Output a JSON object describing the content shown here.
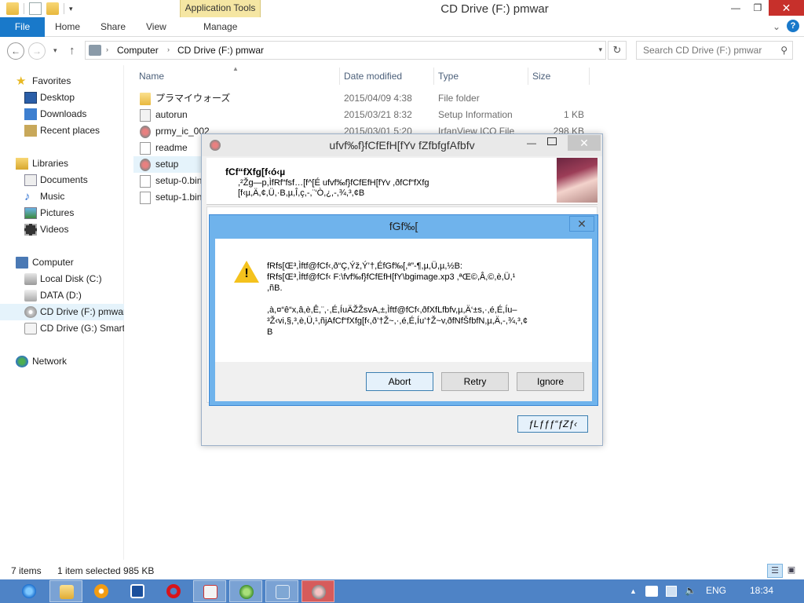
{
  "window": {
    "title": "CD Drive (F:) pmwar",
    "contextual_tab": "Application Tools",
    "minimize": "—",
    "maximize": "❐",
    "close": "✕"
  },
  "ribbon": {
    "tabs": [
      "File",
      "Home",
      "Share",
      "View",
      "Manage"
    ],
    "expand": "⌄",
    "help": "?"
  },
  "address": {
    "back": "←",
    "forward": "→",
    "up": "↑",
    "crumbs": [
      "Computer",
      "CD Drive (F:) pmwar"
    ],
    "refresh": "↻",
    "search_placeholder": "Search CD Drive (F:) pmwar"
  },
  "navpane": {
    "favorites": "Favorites",
    "fav_items": [
      "Desktop",
      "Downloads",
      "Recent places"
    ],
    "libraries": "Libraries",
    "lib_items": [
      "Documents",
      "Music",
      "Pictures",
      "Videos"
    ],
    "computer": "Computer",
    "comp_items": [
      "Local Disk (C:)",
      "DATA (D:)",
      "CD Drive (F:) pmwar",
      "CD Drive (G:) Smartf"
    ],
    "network": "Network"
  },
  "filelist": {
    "columns": [
      "Name",
      "Date modified",
      "Type",
      "Size"
    ],
    "rows": [
      {
        "name": "プラマイウォーズ",
        "date": "2015/04/09 4:38",
        "type": "File folder",
        "size": ""
      },
      {
        "name": "autorun",
        "date": "2015/03/21 8:32",
        "type": "Setup Information",
        "size": "1 KB"
      },
      {
        "name": "prmy_ic_002",
        "date": "2015/03/01 5:20",
        "type": "IrfanView ICO File",
        "size": "298 KB"
      },
      {
        "name": "readme",
        "date": "",
        "type": "",
        "size": ""
      },
      {
        "name": "setup",
        "date": "",
        "type": "",
        "size": ""
      },
      {
        "name": "setup-0.bin",
        "date": "",
        "type": "",
        "size": ""
      },
      {
        "name": "setup-1.bin",
        "date": "",
        "type": "",
        "size": ""
      }
    ]
  },
  "status": {
    "count": "7 items",
    "selected": "1 item selected  985 KB"
  },
  "installer": {
    "title": "ufvf‰f}fCfEfH[fYv fZfbfgfAfbfv",
    "heading": "fCf“fXfg[f‹ó‹µ",
    "line1": ",²Žg—p,ÌfRf“fsf…[f^[É ufvf‰f}fCfEfH[fYv ,ðfCf“fXfg",
    "line2": "[f‹µ,Ä,¢,Ü,·B,µ,Î,ç,-,¨‘Ò,¿,-,¾,³,¢B",
    "cancel": "ƒLƒƒƒ“ƒZƒ‹"
  },
  "dialog": {
    "title": "fGf‰[",
    "close": "✕",
    "msg1": "fRfs[Œ³,Ìftf@fCf‹,ð“Ç,Ýž,Ý’†,ÉfGf‰[,ª”-¶,µ,Ü,µ,½B:",
    "msg2": "fRfs[Œ³,Ìftf@fCf‹ F:\\fvf‰f}fCfEfH[fY\\bgimage.xp3 ,ªŒ©,Â,©,è,Ü,¹",
    "msg3": ",ñB.",
    "msg4": ",à,¤“ê“x,â,è,Ê,¨,·,É,ÍuÄŽŽsvA,±,Ìftf@fCf‹,ðfXfLfbfv,µ,Ä‘±s,·,é,É,Íu–",
    "msg5": "³Ž‹vi,§,³,è,Ü,¹,ñjAfCf“fXfg[f‹,ð’†Ž~,·,é,É,Íu’†Ž~v,ðfNfŠfbfN,µ,Ä,-,¾,³,¢",
    "msg6": "B",
    "buttons": [
      "Abort",
      "Retry",
      "Ignore"
    ]
  },
  "taskbar": {
    "lang": "ENG",
    "time": "18:34",
    "tray_up": "▲"
  }
}
